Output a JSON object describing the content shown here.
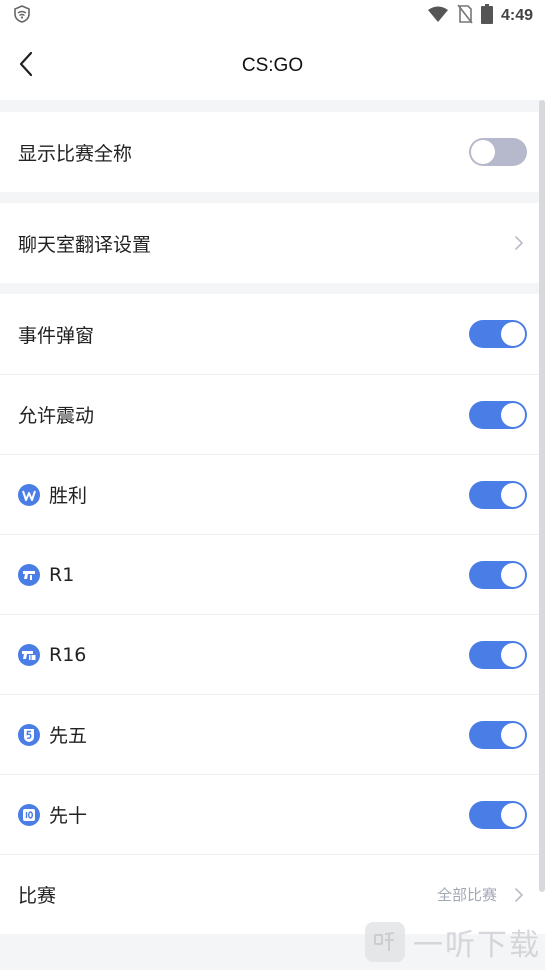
{
  "status_bar": {
    "time": "4:49"
  },
  "header": {
    "title": "CS:GO"
  },
  "settings": {
    "show_full_name": {
      "label": "显示比赛全称",
      "enabled": false
    },
    "chat_translation": {
      "label": "聊天室翻译设置"
    },
    "event_popup": {
      "label": "事件弹窗",
      "enabled": true
    },
    "vibration": {
      "label": "允许震动",
      "enabled": true
    },
    "win": {
      "label": "胜利",
      "icon": "win-badge-icon",
      "enabled": true
    },
    "r1": {
      "label": "R1",
      "icon": "pistol-round-icon",
      "enabled": true
    },
    "r16": {
      "label": "R16",
      "icon": "pistol-round-16-icon",
      "enabled": true
    },
    "first_five": {
      "label": "先五",
      "icon": "first-five-badge-icon",
      "enabled": true
    },
    "first_ten": {
      "label": "先十",
      "icon": "first-ten-badge-icon",
      "enabled": true
    },
    "matches": {
      "label": "比赛",
      "value": "全部比赛"
    }
  },
  "watermark": {
    "text": "一听下载"
  },
  "colors": {
    "accent": "#4a7de6",
    "toggle_off": "#b6b9cc",
    "background": "#f4f5f7",
    "icon_blue": "#4a7de6"
  }
}
